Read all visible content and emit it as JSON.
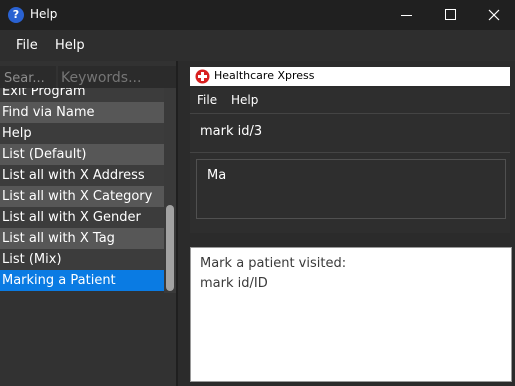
{
  "window": {
    "title": "Help",
    "app_icon_glyph": "?"
  },
  "menu": {
    "file": "File",
    "help": "Help"
  },
  "search": {
    "value": "Sear...",
    "keywords_placeholder": "Keywords..."
  },
  "commands": [
    "Exit Program",
    "Find via Name",
    "Help",
    "List (Default)",
    "List all with X Address",
    "List all with X Category",
    "List all with X Gender",
    "List all with X Tag",
    "List (Mix)",
    "Marking a Patient"
  ],
  "selected_index": 9,
  "preview": {
    "title": "Healthcare Xpress",
    "menu": {
      "file": "File",
      "help": "Help"
    },
    "command": "mark id/3",
    "result": "Ma"
  },
  "help_text": {
    "line1": "Mark a patient visited:",
    "line2": "mark id/ID"
  },
  "colors": {
    "selection": "#0a7be3",
    "app_icon": "#2a62d2",
    "brand_red": "#d82020"
  }
}
